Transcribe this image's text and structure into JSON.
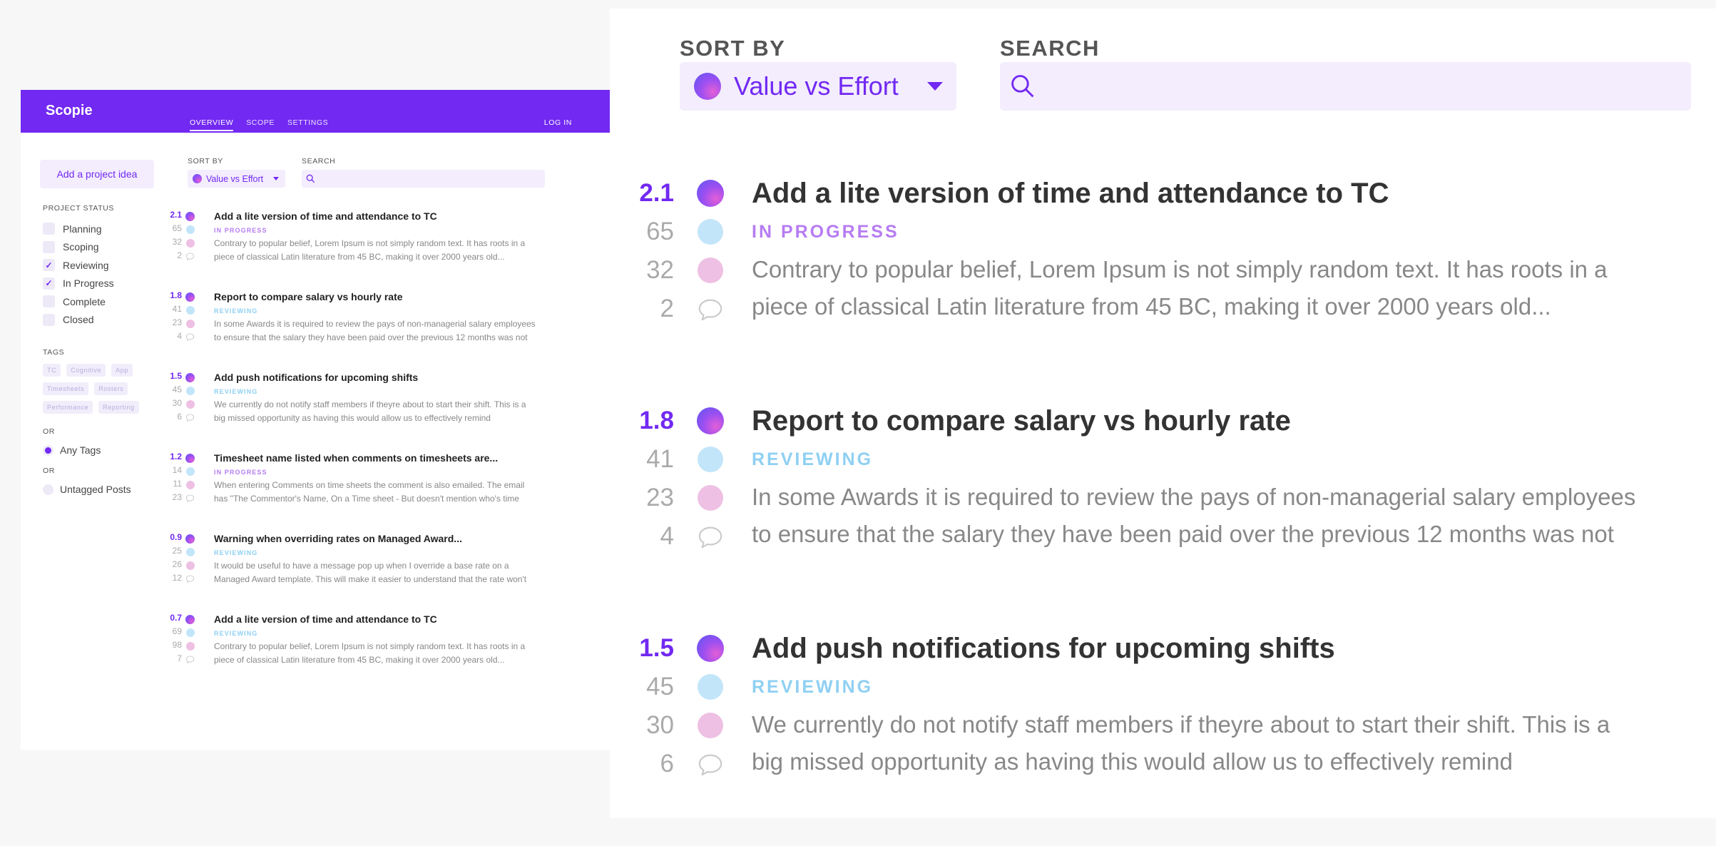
{
  "app": {
    "name": "Scopie",
    "nav": [
      "OVERVIEW",
      "SCOPE",
      "SETTINGS"
    ],
    "login": "LOG IN"
  },
  "sidebar": {
    "add_button": "Add a project idea",
    "status_heading": "PROJECT STATUS",
    "statuses": [
      {
        "label": "Planning",
        "checked": false
      },
      {
        "label": "Scoping",
        "checked": false
      },
      {
        "label": "Reviewing",
        "checked": true
      },
      {
        "label": "In Progress",
        "checked": true
      },
      {
        "label": "Complete",
        "checked": false
      },
      {
        "label": "Closed",
        "checked": false
      }
    ],
    "tags_heading": "TAGS",
    "tags": [
      "TC",
      "Cognitive",
      "App",
      "Timesheets",
      "Rosters",
      "Performance",
      "Reporting"
    ],
    "or_1": "OR",
    "any_tags": "Any Tags",
    "or_2": "OR",
    "untagged": "Untagged Posts"
  },
  "toolbar": {
    "sort_label": "SORT BY",
    "sort_value": "Value vs Effort",
    "search_label": "SEARCH",
    "search_placeholder": ""
  },
  "colors": {
    "accent": "#7229f2",
    "in_progress": "#b67cf2",
    "reviewing": "#8fd0f3"
  },
  "ideas": [
    {
      "score": "2.1",
      "value": "65",
      "effort": "32",
      "comments": "2",
      "title": "Add a lite version of time and attendance to TC",
      "status": "IN PROGRESS",
      "desc1": "Contrary to popular belief, Lorem Ipsum is not simply random text. It has roots in a",
      "desc2": "piece of classical Latin literature from 45 BC, making it over 2000 years old..."
    },
    {
      "score": "1.8",
      "value": "41",
      "effort": "23",
      "comments": "4",
      "title": "Report to compare salary vs hourly rate",
      "status": "REVIEWING",
      "desc1": "In some Awards it is required to review the pays of non-managerial salary employees",
      "desc2": "to ensure that the salary they have been paid over the previous 12 months was not"
    },
    {
      "score": "1.5",
      "value": "45",
      "effort": "30",
      "comments": "6",
      "title": "Add push notifications for upcoming shifts",
      "status": "REVIEWING",
      "desc1": "We currently do not notify staff members if theyre about to start their shift. This is a",
      "desc2": "big missed opportunity as having this would allow us to effectively remind"
    },
    {
      "score": "1.2",
      "value": "14",
      "effort": "11",
      "comments": "23",
      "title": "Timesheet name listed when comments on timesheets are...",
      "status": "IN PROGRESS",
      "desc1": "When entering Comments on time sheets the comment is also emailed. The email",
      "desc2": "has \"The Commentor's Name, On a Time sheet - But doesn't mention who's time"
    },
    {
      "score": "0.9",
      "value": "25",
      "effort": "26",
      "comments": "12",
      "title": "Warning when overriding rates on Managed Award...",
      "status": "REVIEWING",
      "desc1": "It would be useful to have a message pop up when I override a base rate on a",
      "desc2": "Managed Award template. This will make it easier to understand that the rate won't"
    },
    {
      "score": "0.7",
      "value": "69",
      "effort": "98",
      "comments": "7",
      "title": "Add a lite version of time and attendance to TC",
      "status": "REVIEWING",
      "desc1": "Contrary to popular belief, Lorem Ipsum is not simply random text. It has roots in a",
      "desc2": "piece of classical Latin literature from 45 BC, making it over 2000 years old..."
    }
  ]
}
